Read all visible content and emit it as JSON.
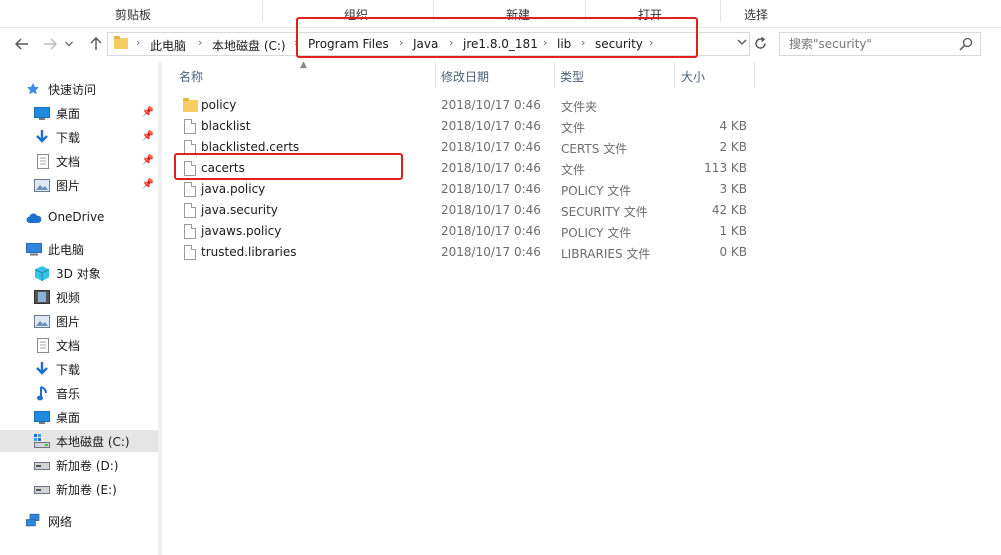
{
  "ribbon": {
    "groups": [
      "剪贴板",
      "组织",
      "新建",
      "打开",
      "选择"
    ]
  },
  "address": {
    "crumbs": [
      "此电脑",
      "本地磁盘 (C:)",
      "Program Files",
      "Java",
      "jre1.8.0_181",
      "lib",
      "security"
    ],
    "back_icon": "arrow-left-icon",
    "forward_icon": "arrow-right-icon",
    "recent_icon": "chevron-down-icon",
    "up_icon": "arrow-up-icon"
  },
  "search": {
    "placeholder": "搜索\"security\""
  },
  "sidebar": {
    "quick_access": "快速访问",
    "quick_items": [
      {
        "label": "桌面",
        "icon": "desktop-icon"
      },
      {
        "label": "下载",
        "icon": "download-icon"
      },
      {
        "label": "文档",
        "icon": "document-icon"
      },
      {
        "label": "图片",
        "icon": "pictures-icon"
      }
    ],
    "onedrive": "OneDrive",
    "this_pc": "此电脑",
    "pc_items": [
      {
        "label": "3D 对象",
        "icon": "3d-objects-icon"
      },
      {
        "label": "视频",
        "icon": "video-icon"
      },
      {
        "label": "图片",
        "icon": "pictures-icon"
      },
      {
        "label": "文档",
        "icon": "document-icon"
      },
      {
        "label": "下载",
        "icon": "download-icon"
      },
      {
        "label": "音乐",
        "icon": "music-icon"
      },
      {
        "label": "桌面",
        "icon": "desktop-icon"
      },
      {
        "label": "本地磁盘 (C:)",
        "icon": "drive-c-icon"
      },
      {
        "label": "新加卷 (D:)",
        "icon": "drive-icon"
      },
      {
        "label": "新加卷 (E:)",
        "icon": "drive-icon"
      }
    ],
    "network": "网络"
  },
  "columns": {
    "name": "名称",
    "date": "修改日期",
    "type": "类型",
    "size": "大小"
  },
  "files": [
    {
      "name": "policy",
      "date": "2018/10/17 0:46",
      "type": "文件夹",
      "size": "",
      "kind": "folder"
    },
    {
      "name": "blacklist",
      "date": "2018/10/17 0:46",
      "type": "文件",
      "size": "4 KB",
      "kind": "file"
    },
    {
      "name": "blacklisted.certs",
      "date": "2018/10/17 0:46",
      "type": "CERTS 文件",
      "size": "2 KB",
      "kind": "file"
    },
    {
      "name": "cacerts",
      "date": "2018/10/17 0:46",
      "type": "文件",
      "size": "113 KB",
      "kind": "file"
    },
    {
      "name": "java.policy",
      "date": "2018/10/17 0:46",
      "type": "POLICY 文件",
      "size": "3 KB",
      "kind": "file"
    },
    {
      "name": "java.security",
      "date": "2018/10/17 0:46",
      "type": "SECURITY 文件",
      "size": "42 KB",
      "kind": "file"
    },
    {
      "name": "javaws.policy",
      "date": "2018/10/17 0:46",
      "type": "POLICY 文件",
      "size": "1 KB",
      "kind": "file"
    },
    {
      "name": "trusted.libraries",
      "date": "2018/10/17 0:46",
      "type": "LIBRARIES 文件",
      "size": "0 KB",
      "kind": "file"
    }
  ],
  "colors": {
    "highlight": "#e02020",
    "folder": "#f5cd63",
    "header_text": "#4c607a"
  }
}
